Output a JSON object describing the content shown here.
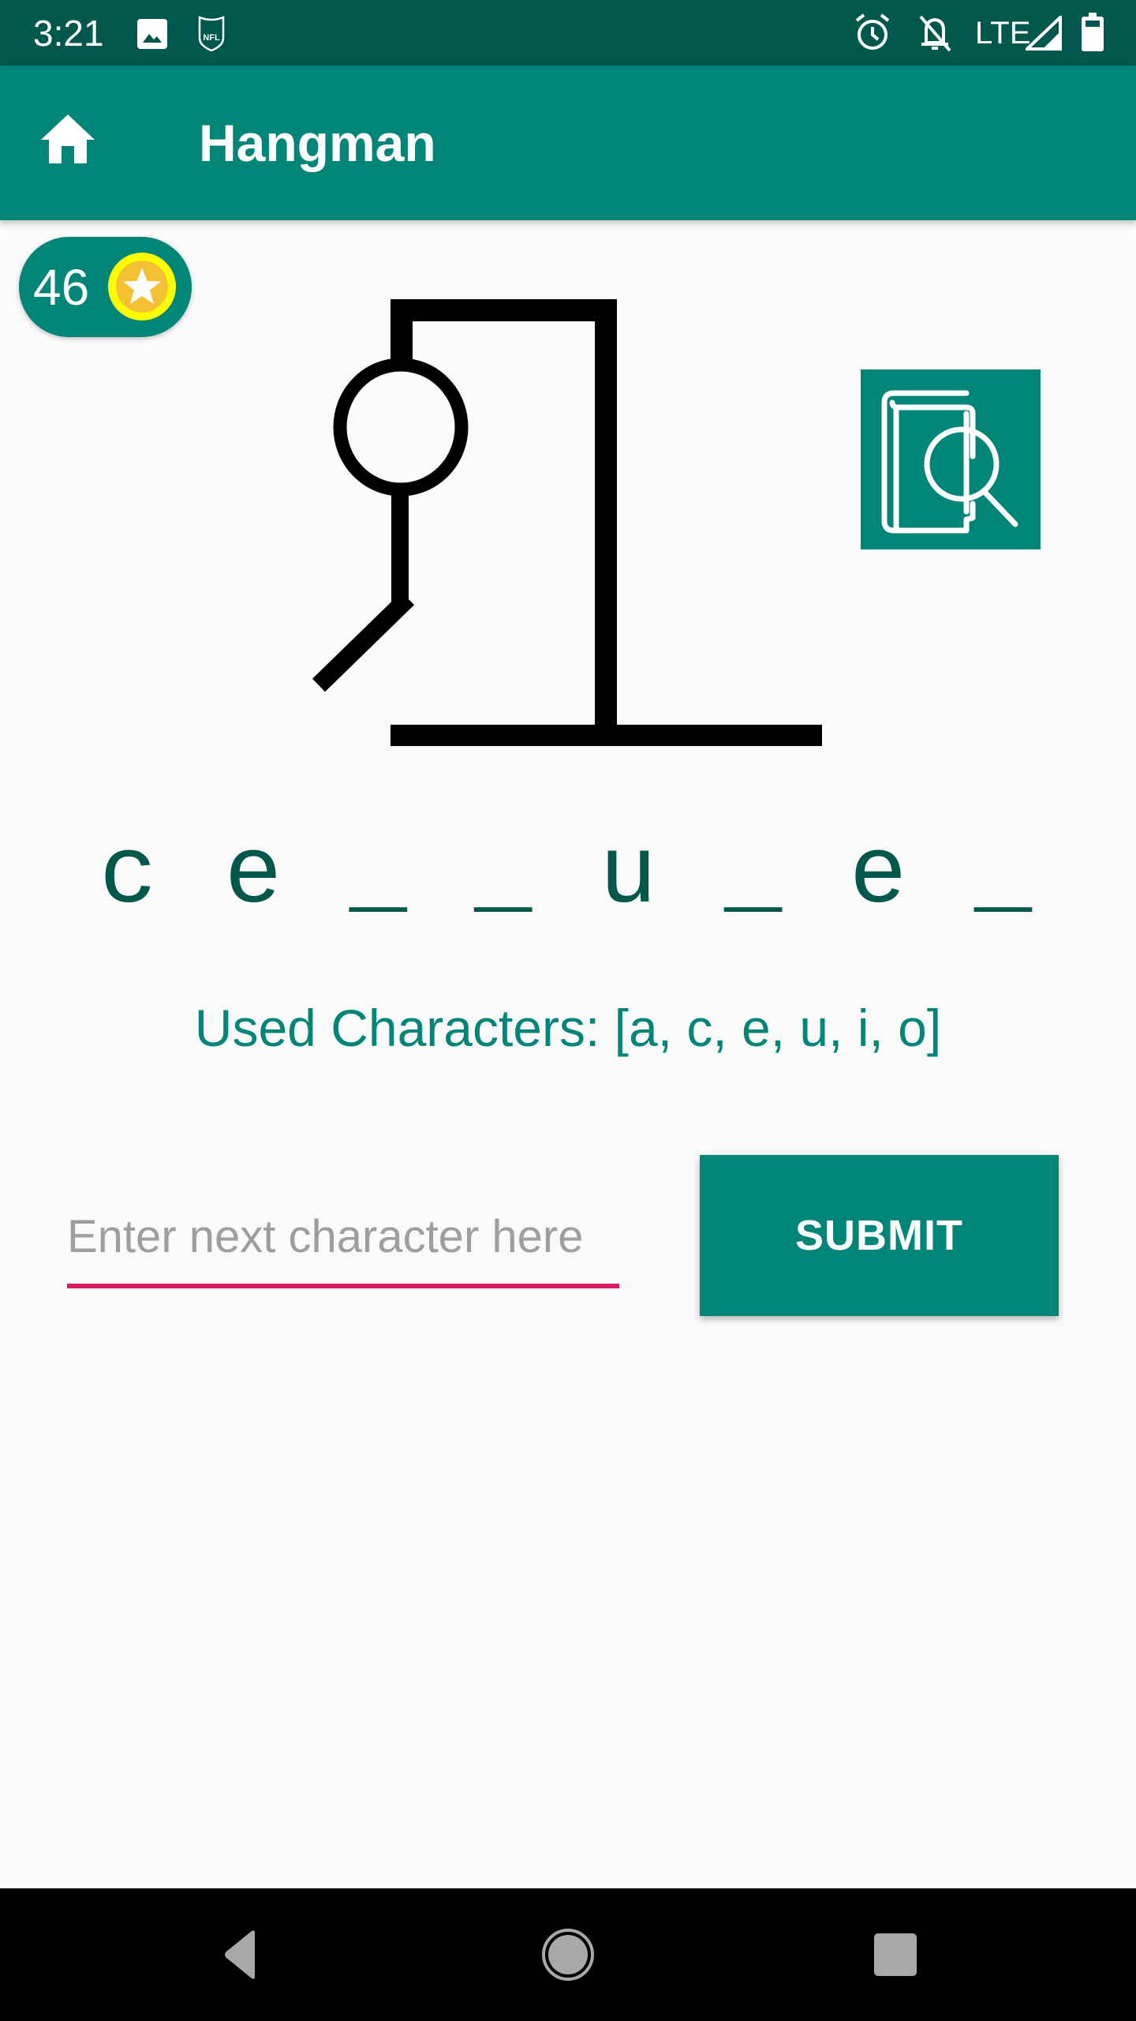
{
  "status_bar": {
    "time": "3:21",
    "left_icons": [
      "image-icon",
      "nfl-icon"
    ],
    "right_icons": [
      "alarm-icon",
      "notifications-off-icon",
      "signal-icon",
      "battery-icon"
    ],
    "network": "LTE"
  },
  "app_bar": {
    "title": "Hangman",
    "home_icon": "home-icon"
  },
  "coins": {
    "count": "46",
    "icon": "star-coin-icon"
  },
  "hangman": {
    "parts_drawn": [
      "head",
      "body",
      "left-leg"
    ],
    "hint_icon": "book-search-icon"
  },
  "game": {
    "masked_word": "c e _ _ u _ e _",
    "used_characters_label": "Used Characters: [a, c, e, u, i, o]"
  },
  "input": {
    "value": "",
    "placeholder": "Enter next character here"
  },
  "buttons": {
    "submit_label": "SUBMIT"
  },
  "colors": {
    "primary": "#008577",
    "primary_dark": "#00574B",
    "accent": "#D81B60"
  },
  "nav_bar": {
    "back_icon": "back-icon",
    "home_icon": "home-circle-icon",
    "recents_icon": "recents-icon"
  }
}
